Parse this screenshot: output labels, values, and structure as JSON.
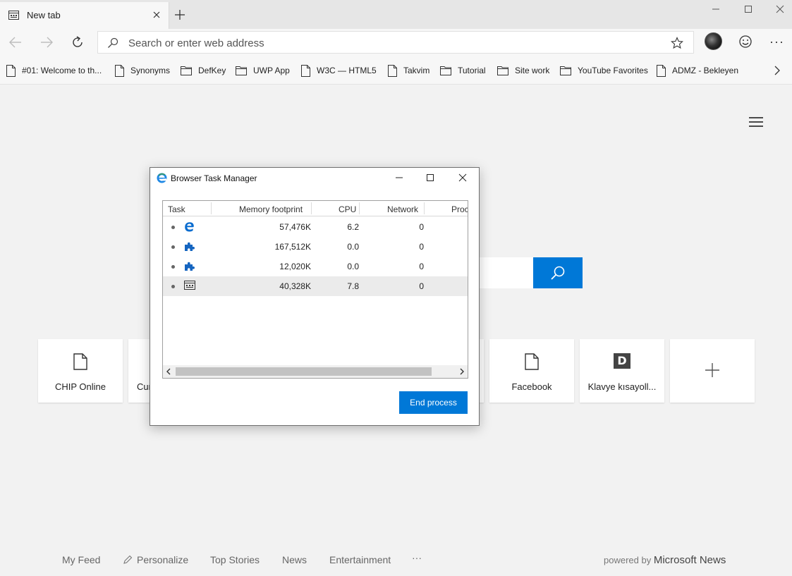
{
  "tab": {
    "title": "New tab"
  },
  "address": {
    "placeholder": "Search or enter web address"
  },
  "favorites": [
    {
      "label": "#01: Welcome to th...",
      "icon": "page-icon"
    },
    {
      "label": "Synonyms",
      "icon": "page-icon"
    },
    {
      "label": "DefKey",
      "icon": "folder-icon"
    },
    {
      "label": "UWP App",
      "icon": "folder-icon"
    },
    {
      "label": "W3C — HTML5",
      "icon": "page-icon"
    },
    {
      "label": "Takvim",
      "icon": "page-icon"
    },
    {
      "label": "Tutorial",
      "icon": "folder-icon"
    },
    {
      "label": "Site work",
      "icon": "folder-icon"
    },
    {
      "label": "YouTube Favorites",
      "icon": "folder-icon"
    },
    {
      "label": "ADMZ - Bekleyen",
      "icon": "page-icon"
    }
  ],
  "tiles": [
    {
      "label": "CHIP Online",
      "icon": "page-icon"
    },
    {
      "label": "Cur",
      "icon": "page-icon"
    },
    {
      "label": "Facebook",
      "icon": "page-icon"
    },
    {
      "label": "Klavye kısayoll...",
      "icon": "D"
    }
  ],
  "bottom_nav": [
    "My Feed",
    "Personalize",
    "Top Stories",
    "News",
    "Entertainment",
    "···"
  ],
  "powered": {
    "prefix": "powered by",
    "brand": "Microsoft News"
  },
  "task_manager": {
    "title": "Browser Task Manager",
    "columns": [
      "Task",
      "Memory footprint",
      "CPU",
      "Network",
      "Proc"
    ],
    "rows": [
      {
        "icon": "edge-icon",
        "memory": "57,476K",
        "cpu": "6.2",
        "network": "0",
        "selected": false
      },
      {
        "icon": "extension-icon",
        "memory": "167,512K",
        "cpu": "0.0",
        "network": "0",
        "selected": false
      },
      {
        "icon": "extension-icon",
        "memory": "12,020K",
        "cpu": "0.0",
        "network": "0",
        "selected": false
      },
      {
        "icon": "tab-page-icon",
        "memory": "40,328K",
        "cpu": "7.8",
        "network": "0",
        "selected": true
      }
    ],
    "end_button": "End process"
  },
  "colors": {
    "accent": "#0078d7",
    "page_bg": "#f2f2f2"
  }
}
